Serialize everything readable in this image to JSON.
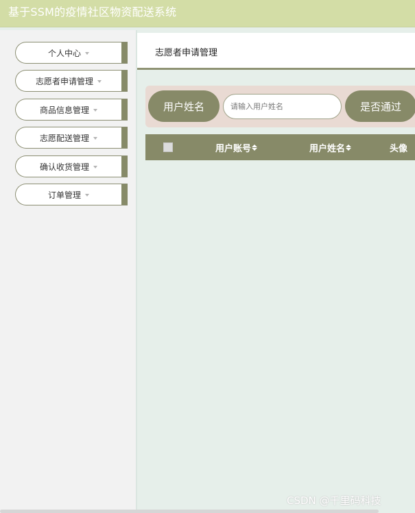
{
  "app": {
    "title": "基于SSM的疫情社区物资配送系统"
  },
  "sidebar": {
    "items": [
      {
        "label": "个人中心"
      },
      {
        "label": "志愿者申请管理"
      },
      {
        "label": "商品信息管理"
      },
      {
        "label": "志愿配送管理"
      },
      {
        "label": "确认收货管理"
      },
      {
        "label": "订单管理"
      }
    ]
  },
  "header": {
    "title": "志愿者申请管理"
  },
  "search": {
    "label": "用户姓名",
    "placeholder": "请输入用户姓名",
    "value": "",
    "filter_label": "是否通过"
  },
  "table": {
    "columns": [
      "用户账号",
      "用户姓名",
      "头像"
    ]
  },
  "watermark": "CSDN @千里码科技",
  "colors": {
    "topbar": "#d3dda6",
    "accent": "#878a68",
    "searchbar": "#e9dad3",
    "content_bg": "#e6efea",
    "sidebar_bg": "#f2f2f2"
  }
}
